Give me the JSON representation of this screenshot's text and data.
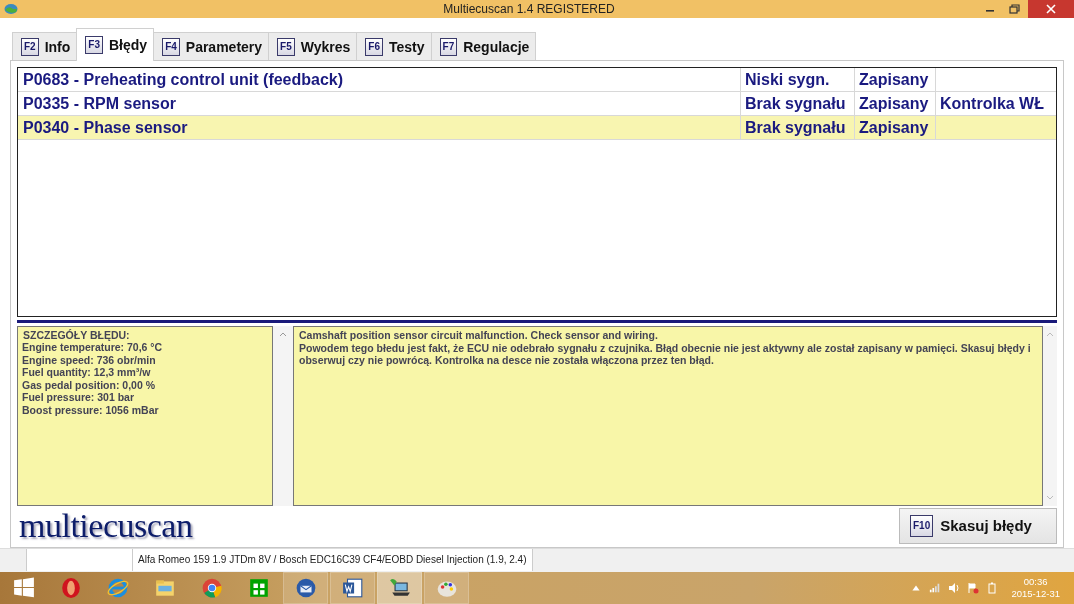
{
  "window": {
    "title": "Multiecuscan 1.4 REGISTERED"
  },
  "tabs": [
    {
      "key": "F2",
      "label": "Info",
      "selected": false
    },
    {
      "key": "F3",
      "label": "Błędy",
      "selected": true
    },
    {
      "key": "F4",
      "label": "Parametery",
      "selected": false
    },
    {
      "key": "F5",
      "label": "Wykres",
      "selected": false
    },
    {
      "key": "F6",
      "label": "Testy",
      "selected": false
    },
    {
      "key": "F7",
      "label": "Regulacje",
      "selected": false
    }
  ],
  "faults": [
    {
      "description": "P0683 - Preheating control unit (feedback)",
      "signal": "Niski sygn.",
      "status": "Zapisany",
      "selected": false
    },
    {
      "description": "P0335 - RPM sensor",
      "signal": "Brak sygnału",
      "status": "Zapisany",
      "lamp": "Kontrolka WŁ",
      "selected": false
    },
    {
      "description": "P0340 - Phase sensor",
      "signal": "Brak sygnału",
      "status": "Zapisany",
      "selected": true
    }
  ],
  "details": {
    "heading": "SZCZEGÓŁY BŁĘDU:",
    "lines": [
      "Engine temperature: 70,6 °C",
      "Engine speed: 736 obr/min",
      "Fuel quantity: 12,3 mm³/w",
      "Gas pedal position: 0,00 %",
      "Fuel pressure: 301 bar",
      "Boost pressure: 1056 mBar"
    ]
  },
  "description": {
    "lines": [
      "Camshaft position sensor circuit malfunction. Check sensor and wiring.",
      "Powodem tego błedu jest fakt, że ECU nie odebrało sygnału z czujnika. Błąd obecnie nie jest aktywny ale został zapisany w pamięci. Skasuj błędy i obserwuj czy nie powrócą. Kontrolka na desce nie została włączona przez ten błąd."
    ]
  },
  "logo": "multiecuscan",
  "clear_button": {
    "key": "F10",
    "label": "Skasuj błędy"
  },
  "status_bar": {
    "vehicle": "Alfa Romeo 159 1.9 JTDm 8V / Bosch EDC16C39 CF4/EOBD Diesel Injection (1.9, 2.4)"
  },
  "taskbar": {
    "apps": [
      {
        "kind": "start",
        "running": false,
        "selected": false
      },
      {
        "kind": "opera",
        "running": false,
        "selected": false
      },
      {
        "kind": "ie",
        "running": false,
        "selected": false
      },
      {
        "kind": "explorer",
        "running": false,
        "selected": false
      },
      {
        "kind": "chrome",
        "running": false,
        "selected": false
      },
      {
        "kind": "store",
        "running": false,
        "selected": false
      },
      {
        "kind": "mail",
        "running": true,
        "selected": false
      },
      {
        "kind": "word",
        "running": true,
        "selected": false
      },
      {
        "kind": "scanner",
        "running": true,
        "selected": true
      },
      {
        "kind": "paint",
        "running": true,
        "selected": false
      }
    ],
    "time": "00:36",
    "date": "2015-12-31"
  }
}
